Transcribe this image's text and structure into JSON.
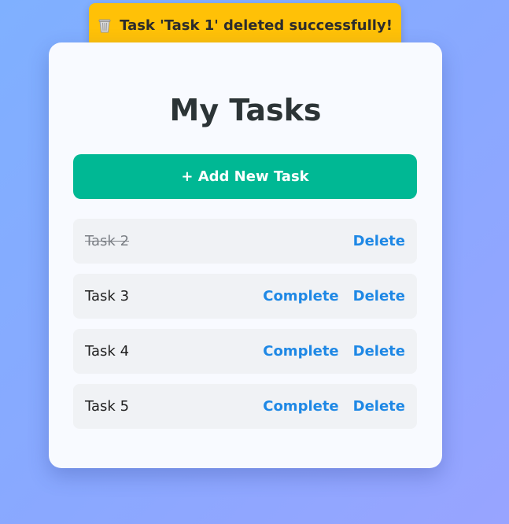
{
  "toast": {
    "icon": "wastebasket-icon",
    "message": "Task 'Task 1' deleted successfully!",
    "color": "#ffc107"
  },
  "page": {
    "title": "My Tasks",
    "add_button_label": "+ Add New Task",
    "accent": "#00b894",
    "link_color": "#1e88e5"
  },
  "tasks": [
    {
      "name": "Task 2",
      "completed": true,
      "complete_label": "",
      "delete_label": "Delete"
    },
    {
      "name": "Task 3",
      "completed": false,
      "complete_label": "Complete",
      "delete_label": "Delete"
    },
    {
      "name": "Task 4",
      "completed": false,
      "complete_label": "Complete",
      "delete_label": "Delete"
    },
    {
      "name": "Task 5",
      "completed": false,
      "complete_label": "Complete",
      "delete_label": "Delete"
    }
  ]
}
